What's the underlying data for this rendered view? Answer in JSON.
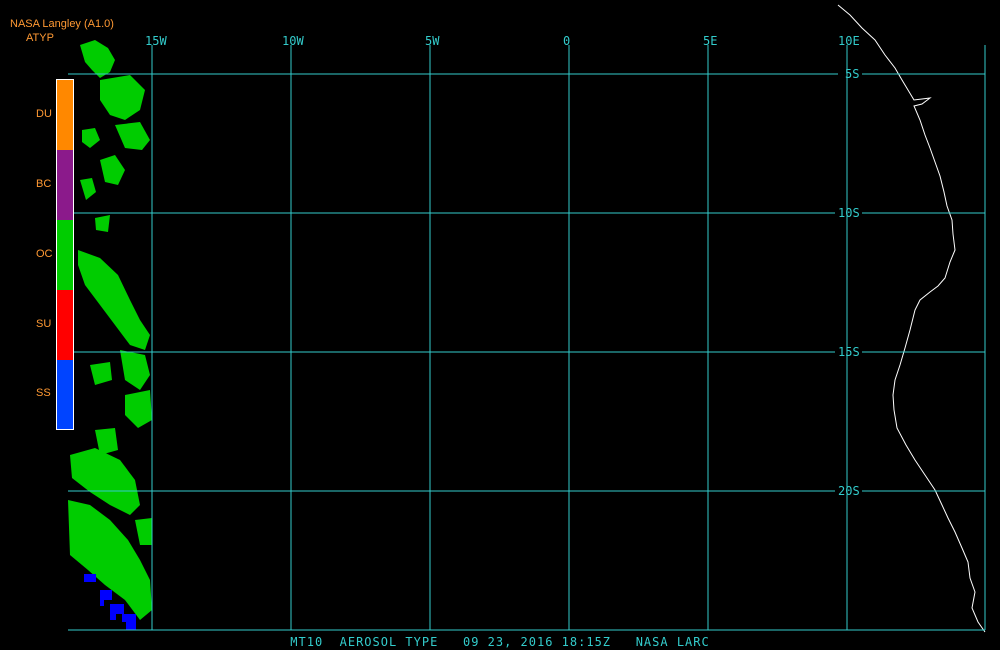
{
  "header": {
    "source": "NASA Langley (A1.0)",
    "product": "ATYP"
  },
  "legend": {
    "items": [
      {
        "label": "DU",
        "color": "#ff8800"
      },
      {
        "label": "BC",
        "color": "#8b1a8b"
      },
      {
        "label": "OC",
        "color": "#00cc00"
      },
      {
        "label": "SU",
        "color": "#ff0000"
      },
      {
        "label": "SS",
        "color": "#0044ff"
      }
    ]
  },
  "grid": {
    "longitudes": [
      "15W",
      "10W",
      "5W",
      "0",
      "5E",
      "10E"
    ],
    "latitudes": [
      "5S",
      "10S",
      "15S",
      "20S"
    ],
    "grid_color": "#33cccc",
    "coast_color": "#ffffff"
  },
  "footer": {
    "caption": "MT10  AEROSOL TYPE   09 23, 2016 18:15Z   NASA LARC"
  }
}
